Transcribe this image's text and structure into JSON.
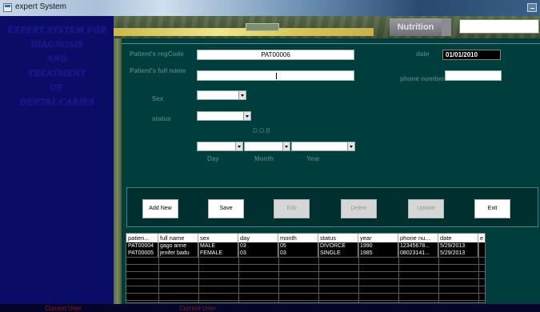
{
  "window": {
    "title": "expert System",
    "icon": "app-window-icon"
  },
  "sidebar": {
    "lines": [
      "EXPERT SYSTEM  FOR",
      "DIAGNOSIS",
      "AND",
      "TREATMENT",
      "OF",
      "DENTAL CARIES"
    ]
  },
  "banner": {
    "nav_label": "Nutrition"
  },
  "form": {
    "regcode_label": "Patient's regCode",
    "regcode_value": "PAT00006",
    "fullname_label": "Patient's  full name",
    "fullname_value": "",
    "date_label": "date",
    "date_value": "01/01/2010",
    "phone_label": "phone number",
    "phone_value": "",
    "sex_label": "Sex",
    "status_label": "status",
    "dob_label": "D.O.B",
    "day_label": "Day",
    "month_label": "Month",
    "year_label": "Year"
  },
  "buttons": {
    "add_new": "Add New",
    "save": "Save",
    "edit": "Edit",
    "delete": "Delete",
    "update": "Update",
    "exit": "Exit"
  },
  "grid": {
    "columns": [
      "patien...",
      "full name",
      "sex",
      "day",
      "month",
      "status",
      "year",
      "phone nu...",
      "date",
      "e"
    ],
    "rows": [
      [
        "PAT00004",
        "gago anne",
        "MALE",
        "03",
        "05",
        "DIVORCE",
        "1990",
        "12345678...",
        "5/29/2013",
        ""
      ],
      [
        "PAT00005",
        "jenifer badu",
        "FEMALE",
        "03",
        "03",
        "SINGLE",
        "1985",
        "08023141...",
        "5/29/2013",
        ""
      ]
    ]
  },
  "footer": {
    "left": "Current User",
    "right": "Current User"
  },
  "colors": {
    "sidebar": "#0b0c66",
    "form_bg": "#003d3d",
    "label": "#4a7f7a"
  }
}
